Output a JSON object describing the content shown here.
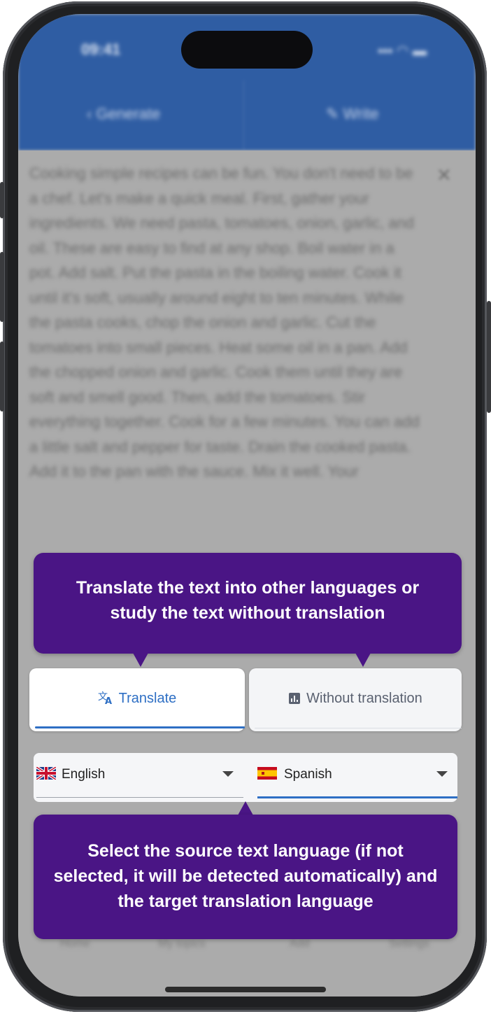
{
  "status_bar": {
    "time": "09:41"
  },
  "header": {
    "tab_generate": "Generate",
    "tab_write": "Write"
  },
  "background_text": "Cooking simple recipes can be fun. You don't need to be a chef. Let's make a quick meal. First, gather your ingredients. We need pasta, tomatoes, onion, garlic, and oil. These are easy to find at any shop. Boil water in a pot. Add salt. Put the pasta in the boiling water. Cook it until it's soft, usually around eight to ten minutes. While the pasta cooks, chop the onion and garlic. Cut the tomatoes into small pieces. Heat some oil in a pan. Add the chopped onion and garlic. Cook them until they are soft and smell good. Then, add the tomatoes. Stir everything together. Cook for a few minutes. You can add a little salt and pepper for taste. Drain the cooked pasta. Add it to the pan with the sauce. Mix it well. Your",
  "bottom_nav": {
    "home": "Home",
    "my_topics": "My topics",
    "add": "Add",
    "settings": "Settings"
  },
  "tooltip_top": "Translate the text into other languages or study the text without translation",
  "mode": {
    "translate_label": "Translate",
    "without_label": "Without translation"
  },
  "languages": {
    "source": "English",
    "target": "Spanish"
  },
  "tooltip_bottom": "Select the source text language (if not selected, it will be detected automatically) and the target translation language",
  "colors": {
    "header": "#2f5da3",
    "tooltip": "#4a1585",
    "accent": "#2e6fc4"
  }
}
